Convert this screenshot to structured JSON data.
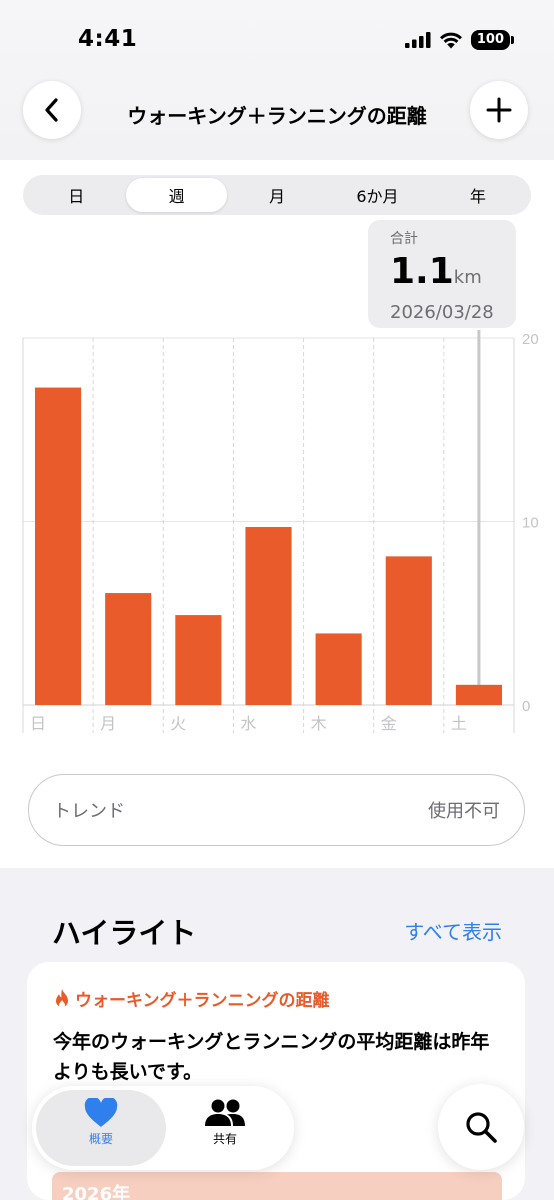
{
  "status_bar": {
    "time": "4:41",
    "battery": "100"
  },
  "nav": {
    "title": "ウォーキング＋ランニングの距離",
    "back_icon": "chevron-left-icon",
    "add_icon": "plus-icon"
  },
  "segments": [
    {
      "label": "日",
      "active": false
    },
    {
      "label": "週",
      "active": true
    },
    {
      "label": "月",
      "active": false
    },
    {
      "label": "6か月",
      "active": false
    },
    {
      "label": "年",
      "active": false
    }
  ],
  "tooltip": {
    "label": "合計",
    "value": "1.1",
    "unit": "km",
    "date": "2026/03/28"
  },
  "chart_data": {
    "type": "bar",
    "categories": [
      "日",
      "月",
      "火",
      "水",
      "木",
      "金",
      "土"
    ],
    "values": [
      17.3,
      6.1,
      4.9,
      9.7,
      3.9,
      8.1,
      1.1
    ],
    "ylim": [
      0,
      20
    ],
    "yticks": [
      "0",
      "10",
      "20"
    ],
    "bar_color": "#EA5B2B",
    "selected_index": 6,
    "grid": true
  },
  "trend": {
    "label": "トレンド",
    "value": "使用不可"
  },
  "highlights": {
    "title": "ハイライト",
    "show_all": "すべて表示",
    "card_category": "ウォーキング＋ランニングの距離",
    "card_text": "今年のウォーキングとランニングの平均距離は昨年よりも長いです。",
    "year_label": "2026年"
  },
  "tabbar": {
    "summary": "概要",
    "sharing": "共有"
  },
  "colors": {
    "accent_orange": "#EA5B2B",
    "accent_blue": "#2F80ED"
  }
}
